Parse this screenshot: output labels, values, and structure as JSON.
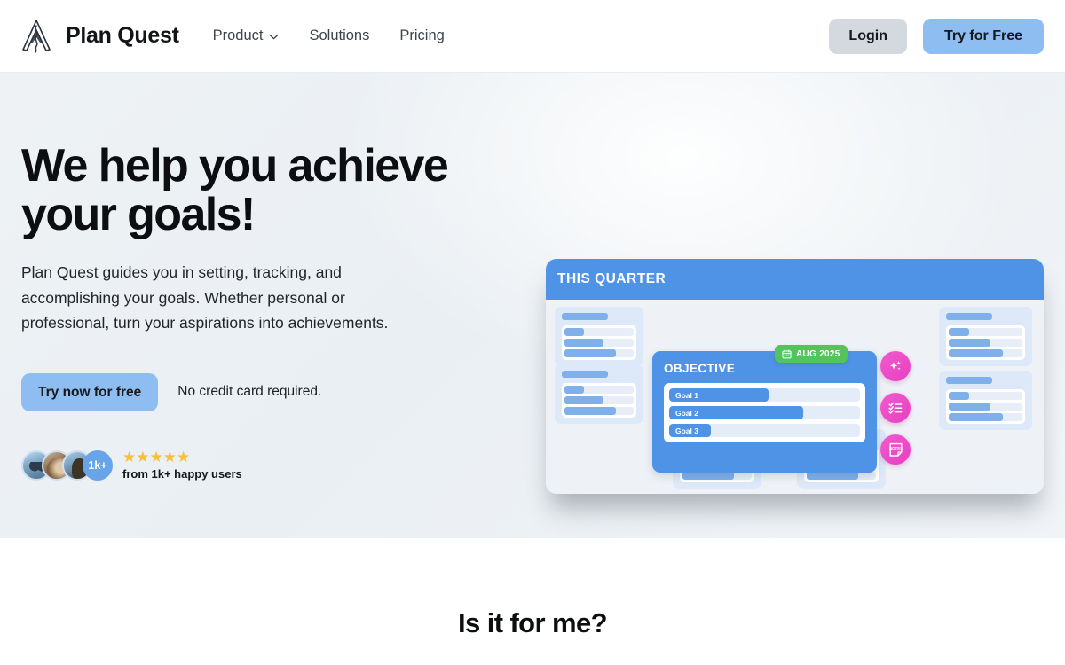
{
  "nav": {
    "logo_icon": "mountain-peak-logo-icon",
    "brand": "Plan Quest",
    "links": [
      {
        "label": "Product",
        "has_dropdown": true,
        "icon": "chevron-down-icon"
      },
      {
        "label": "Solutions",
        "has_dropdown": false
      },
      {
        "label": "Pricing",
        "has_dropdown": false
      }
    ],
    "login_label": "Login",
    "try_label": "Try for Free"
  },
  "hero": {
    "heading": "We help you achieve\nyour goals!",
    "subheading": "Plan Quest guides you in setting, tracking, and\naccomplishing your goals. Whether personal or\nprofessional, turn your aspirations into achievements.",
    "cta_label": "Try now for free",
    "cta_note": "No credit card required.",
    "social_proof": {
      "avatar_count_label": "1k+",
      "stars": "★★★★★",
      "star_count": 5,
      "caption": "from 1k+ happy users"
    }
  },
  "board": {
    "title": "THIS QUARTER",
    "date_badge": {
      "label": "AUG 2025",
      "icon": "calendar-icon",
      "color": "#52c45c"
    },
    "objective": {
      "title": "OBJECTIVE",
      "goals": [
        {
          "label": "Goal 1",
          "progress": 52
        },
        {
          "label": "Goal 2",
          "progress": 70
        },
        {
          "label": "Goal 3",
          "progress": 20
        }
      ]
    },
    "action_pills": [
      {
        "icon": "sparkles-icon"
      },
      {
        "icon": "checklist-icon"
      },
      {
        "icon": "notes-icon"
      }
    ],
    "mini_cards": [
      {
        "position": "left-top",
        "rows": [
          28,
          57,
          74
        ]
      },
      {
        "position": "left-bottom",
        "rows": [
          28,
          57,
          74
        ]
      },
      {
        "position": "right-top",
        "rows": [
          28,
          57,
          74
        ]
      },
      {
        "position": "right-bottom",
        "rows": [
          28,
          57,
          74
        ]
      },
      {
        "position": "bottom-left",
        "rows": [
          25,
          57,
          74
        ]
      },
      {
        "position": "bottom-right",
        "rows": [
          25,
          57,
          74
        ]
      }
    ]
  },
  "section2": {
    "title": "Is it for me?"
  },
  "colors": {
    "primary_blue": "#4f93e6",
    "button_blue": "#8ebdf2",
    "accent_pink": "#e83fc0",
    "badge_green": "#52c45c",
    "star_yellow": "#f5c13b",
    "hero_bg": "#eef2f5"
  }
}
